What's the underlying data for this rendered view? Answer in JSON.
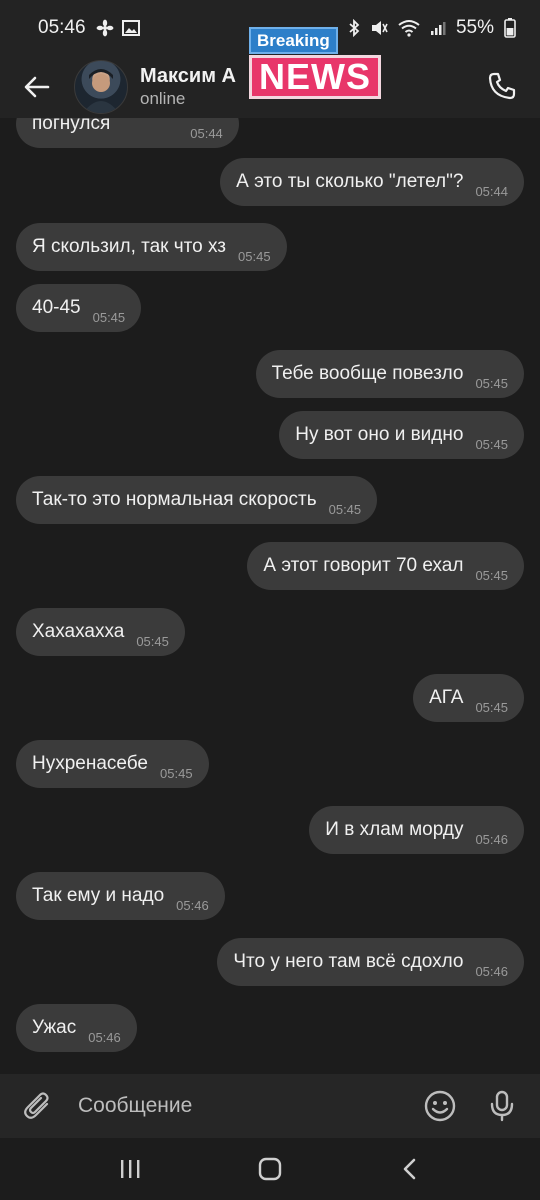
{
  "status_bar": {
    "time": "05:46",
    "battery": "55%",
    "left_icons": [
      "fan-icon",
      "image-icon"
    ],
    "right_icons": [
      "bluetooth-icon",
      "mute-icon",
      "wifi-icon",
      "signal-icon",
      "battery-icon"
    ]
  },
  "header": {
    "contact_name": "Максим А",
    "status": "online"
  },
  "overlay": {
    "breaking": "Breaking",
    "news": "NEWS"
  },
  "messages": [
    {
      "dir": "in",
      "text": "погнулся",
      "time": "05:44"
    },
    {
      "dir": "out",
      "text": "А это ты сколько \"летел\"?",
      "time": "05:44"
    },
    {
      "dir": "in",
      "text": "Я скользил, так что хз",
      "time": "05:45"
    },
    {
      "dir": "in",
      "text": "40-45",
      "time": "05:45"
    },
    {
      "dir": "out",
      "text": "Тебе вообще повезло",
      "time": "05:45"
    },
    {
      "dir": "out",
      "text": "Ну вот оно и видно",
      "time": "05:45"
    },
    {
      "dir": "in",
      "text": "Так-то это нормальная скорость",
      "time": "05:45"
    },
    {
      "dir": "out",
      "text": "А этот говорит 70 ехал",
      "time": "05:45"
    },
    {
      "dir": "in",
      "text": "Хахахахха",
      "time": "05:45"
    },
    {
      "dir": "out",
      "text": "АГА",
      "time": "05:45"
    },
    {
      "dir": "in",
      "text": "Нухренасебе",
      "time": "05:45"
    },
    {
      "dir": "out",
      "text": "И в хлам морду",
      "time": "05:46"
    },
    {
      "dir": "in",
      "text": "Так ему и надо",
      "time": "05:46"
    },
    {
      "dir": "out",
      "text": "Что у него там всё сдохло",
      "time": "05:46"
    },
    {
      "dir": "in",
      "text": "Ужас",
      "time": "05:46"
    }
  ],
  "input": {
    "placeholder": "Сообщение"
  },
  "colors": {
    "background": "#1c1c1c",
    "bubble": "#3b3b3b",
    "bar": "#232323",
    "news_blue": "#2d7fc9",
    "news_pink": "#e8366a"
  }
}
